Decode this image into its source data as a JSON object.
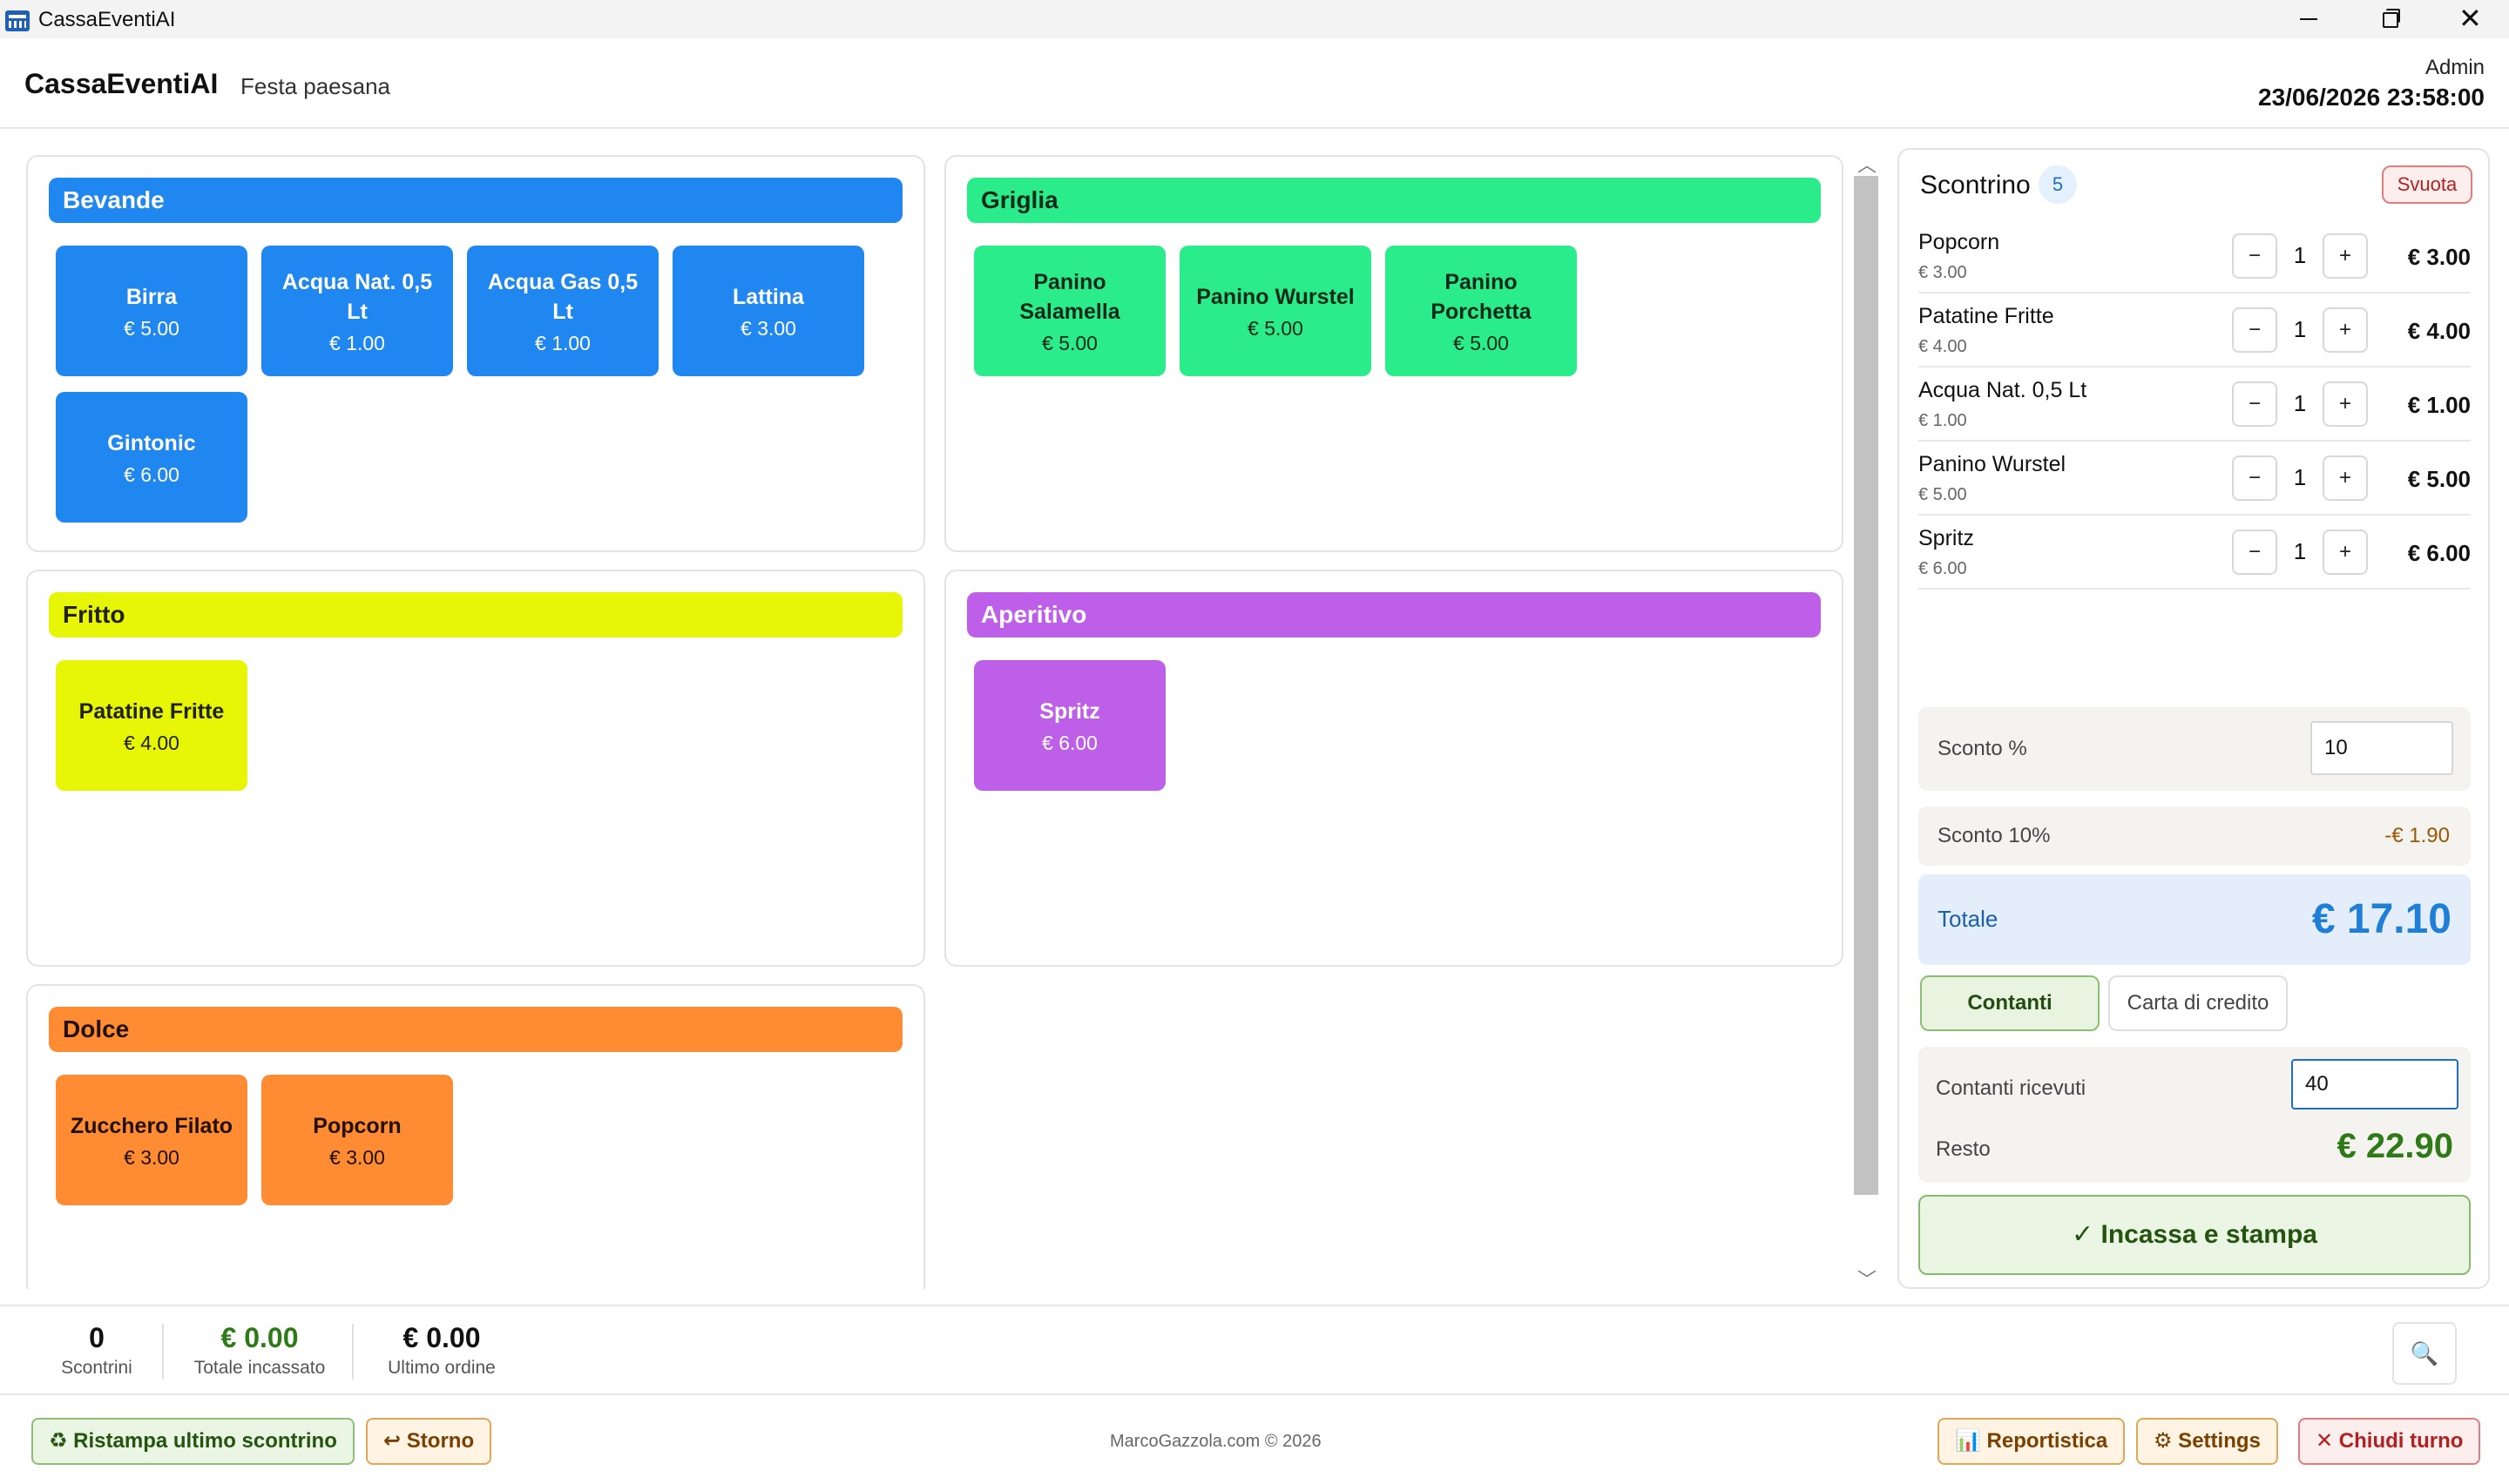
{
  "window": {
    "title": "CassaEventiAI",
    "close_glyph": "✕"
  },
  "header": {
    "brand": "CassaEventiAI",
    "event": "Festa paesana",
    "user": "Admin",
    "datetime": "23/06/2026 23:58:00"
  },
  "categories": [
    {
      "name": "Bevande",
      "color": "#1f87ef",
      "text_color": "#ffffff",
      "products": [
        {
          "name": "Birra",
          "price": "€ 5.00"
        },
        {
          "name": "Acqua Nat. 0,5 Lt",
          "price": "€ 1.00"
        },
        {
          "name": "Acqua Gas 0,5 Lt",
          "price": "€ 1.00"
        },
        {
          "name": "Lattina",
          "price": "€ 3.00"
        },
        {
          "name": "Gintonic",
          "price": "€ 6.00"
        }
      ]
    },
    {
      "name": "Griglia",
      "color": "#2aec8a",
      "text_color": "#0f2a18",
      "products": [
        {
          "name": "Panino Salamella",
          "price": "€ 5.00"
        },
        {
          "name": "Panino Wurstel",
          "price": "€ 5.00"
        },
        {
          "name": "Panino Porchetta",
          "price": "€ 5.00"
        }
      ]
    },
    {
      "name": "Fritto",
      "color": "#e7f507",
      "text_color": "#222200",
      "products": [
        {
          "name": "Patatine Fritte",
          "price": "€ 4.00"
        }
      ]
    },
    {
      "name": "Aperitivo",
      "color": "#bd5fe8",
      "text_color": "#ffffff",
      "products": [
        {
          "name": "Spritz",
          "price": "€ 6.00"
        }
      ]
    },
    {
      "name": "Dolce",
      "color": "#ff8b33",
      "text_color": "#221000",
      "products": [
        {
          "name": "Zucchero Filato",
          "price": "€ 3.00"
        },
        {
          "name": "Popcorn",
          "price": "€ 3.00"
        }
      ]
    }
  ],
  "receipt": {
    "title": "Scontrino",
    "count": "5",
    "clear_label": "Svuota",
    "minus_glyph": "−",
    "plus_glyph": "+",
    "items": [
      {
        "name": "Popcorn",
        "unit": "€ 3.00",
        "qty": "1",
        "total": "€ 3.00"
      },
      {
        "name": "Patatine Fritte",
        "unit": "€ 4.00",
        "qty": "1",
        "total": "€ 4.00"
      },
      {
        "name": "Acqua Nat. 0,5 Lt",
        "unit": "€ 1.00",
        "qty": "1",
        "total": "€ 1.00"
      },
      {
        "name": "Panino Wurstel",
        "unit": "€ 5.00",
        "qty": "1",
        "total": "€ 5.00"
      },
      {
        "name": "Spritz",
        "unit": "€ 6.00",
        "qty": "1",
        "total": "€ 6.00"
      }
    ],
    "discount_label": "Sconto %",
    "discount_value": "10",
    "discount_line_label": "Sconto 10%",
    "discount_line_value": "-€ 1.90",
    "total_label": "Totale",
    "total_value": "€ 17.10",
    "pay_cash": "Contanti",
    "pay_card": "Carta di credito",
    "cash_received_label": "Contanti ricevuti",
    "cash_received_value": "40",
    "change_label": "Resto",
    "change_value": "€ 22.90",
    "pay_button": "✓ Incassa e stampa"
  },
  "stats": [
    {
      "value": "0",
      "label": "Scontrini",
      "color": "#111111"
    },
    {
      "value": "€ 0.00",
      "label": "Totale incassato",
      "color": "#2f7a18"
    },
    {
      "value": "€ 0.00",
      "label": "Ultimo ordine",
      "color": "#111111"
    }
  ],
  "footer": {
    "reprint": "♻ Ristampa ultimo scontrino",
    "storno": "↩ Storno",
    "copyright": "MarcoGazzola.com © 2026",
    "report": "📊 Reportistica",
    "settings": "⚙ Settings",
    "close_shift": "✕ Chiudi turno",
    "search_glyph": "🔍"
  }
}
